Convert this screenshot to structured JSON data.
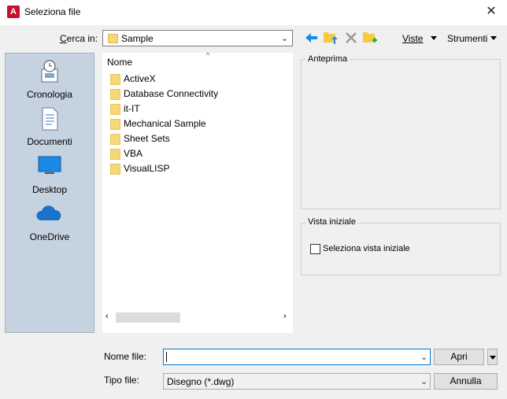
{
  "window": {
    "title": "Seleziona file",
    "close_glyph": "✕"
  },
  "lookin": {
    "label": "Cerca in:",
    "value": "Sample"
  },
  "toolbar": {
    "views_label": "Viste",
    "tools_label": "Strumenti"
  },
  "places": [
    {
      "label": "Cronologia",
      "icon": "history-icon"
    },
    {
      "label": "Documenti",
      "icon": "documents-icon"
    },
    {
      "label": "Desktop",
      "icon": "desktop-icon"
    },
    {
      "label": "OneDrive",
      "icon": "onedrive-icon"
    }
  ],
  "filelist": {
    "column_header": "Nome",
    "items": [
      "ActiveX",
      "Database Connectivity",
      "it-IT",
      "Mechanical Sample",
      "Sheet Sets",
      "VBA",
      "VisualLISP"
    ]
  },
  "preview": {
    "legend": "Anteprima"
  },
  "initial_view": {
    "legend": "Vista iniziale",
    "checkbox_label": "Seleziona vista iniziale"
  },
  "filename": {
    "label": "Nome file:",
    "value": ""
  },
  "filetype": {
    "label": "Tipo file:",
    "value": "Disegno (*.dwg)"
  },
  "buttons": {
    "open": "Apri",
    "cancel": "Annulla"
  },
  "colors": {
    "places_bg": "#c5d2df",
    "folder": "#f6d77a",
    "accent_blue": "#1a8ae6",
    "app_icon": "#c8102e"
  }
}
